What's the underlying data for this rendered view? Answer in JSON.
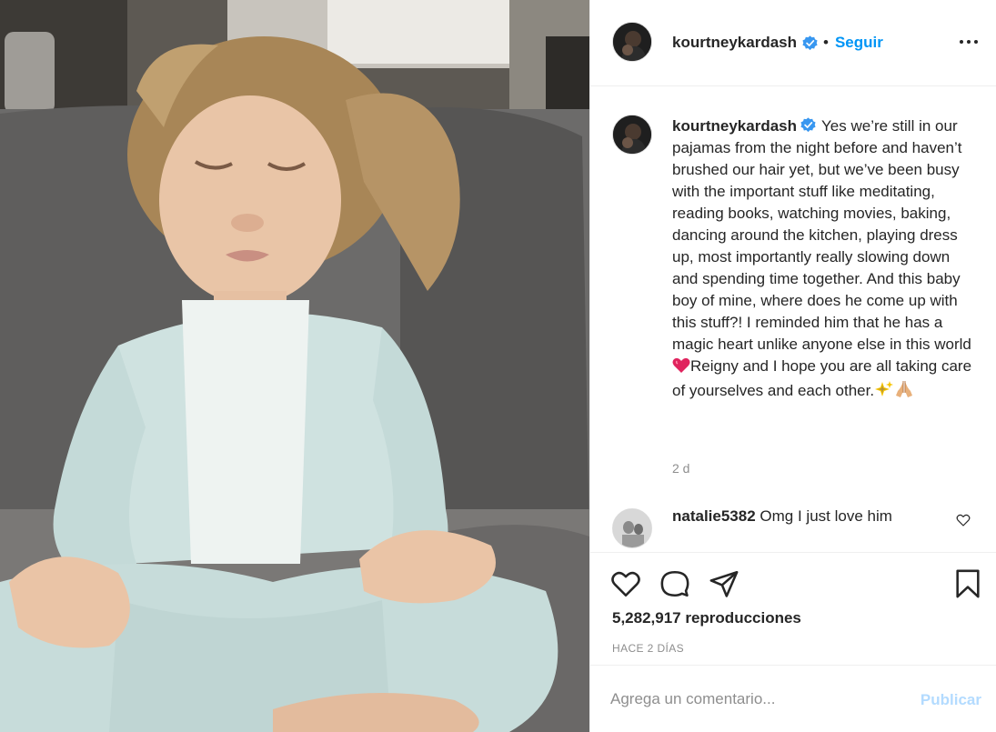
{
  "post": {
    "username": "kourtneykardash",
    "follow_label": "Seguir",
    "separator": "•",
    "caption": {
      "username": "kourtneykardash",
      "text_part1": "Yes we’re still in our pajamas from the night before and haven’t brushed our hair yet, but we’ve been busy with the important stuff like meditating, reading books, watching movies, baking, dancing around the kitchen, playing dress up, most importantly really slowing down and spending time together. And this baby boy of mine, where does he come up with this stuff?! I reminded him that he has a magic heart unlike anyone else in this world",
      "text_part2": "Reigny and I hope you are all taking care of yourselves and each other.",
      "time": "2 d"
    },
    "comment": {
      "username": "natalie5382",
      "text": "Omg I just love him"
    },
    "views": "5,282,917 reproducciones",
    "time_ago": "HACE 2 DÍAS",
    "add_comment": {
      "placeholder": "Agrega un comentario...",
      "publish_label": "Publicar"
    }
  },
  "icons": {
    "verified": "verified-badge-icon",
    "more": "more-options-icon",
    "like": "heart-icon",
    "comment": "comment-icon",
    "share": "share-icon",
    "save": "bookmark-icon"
  },
  "colors": {
    "accent": "#0095f6",
    "publish_disabled": "#b3dbff",
    "text": "#262626",
    "muted": "#8e8e8e",
    "border": "#efefef"
  }
}
